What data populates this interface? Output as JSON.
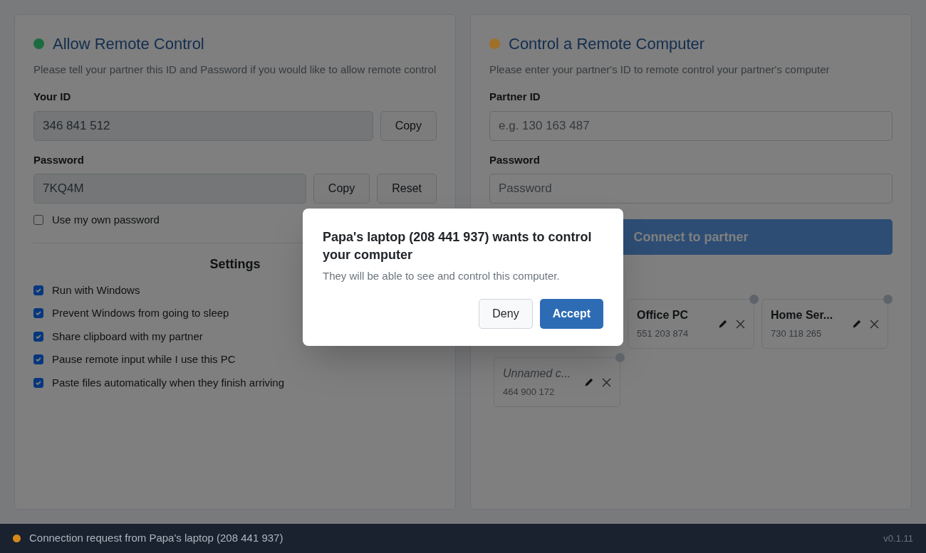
{
  "allow": {
    "title": "Allow Remote Control",
    "color": "#1d6b40",
    "description": "Please tell your partner this ID and Password if you would like to allow remote control",
    "id_label": "Your ID",
    "id_value": "346 841 512",
    "id_copy": "Copy",
    "password_label": "Password",
    "password_value": "7KQ4M",
    "password_copy": "Copy",
    "password_reset": "Reset",
    "own_password": {
      "label": "Use my own password",
      "checked": false
    },
    "settings_title": "Settings",
    "settings": [
      {
        "label": "Run with Windows",
        "checked": true
      },
      {
        "label": "Prevent Windows from going to sleep",
        "checked": true
      },
      {
        "label": "Share clipboard with my partner",
        "checked": true
      },
      {
        "label": "Pause remote input while I use this PC",
        "checked": true
      },
      {
        "label": "Paste files automatically when they finish arriving",
        "checked": true
      }
    ]
  },
  "control": {
    "title": "Control a Remote Computer",
    "color": "#a0702a",
    "description": "Please enter your partner's ID to remote control your partner's computer",
    "partner_id_label": "Partner ID",
    "partner_id_placeholder": "e.g. 130 163 487",
    "password_label": "Password",
    "password_placeholder": "Password",
    "connect": "Connect to partner",
    "partners": [
      {
        "kind": "hidden"
      },
      {
        "kind": "named",
        "name": "Office PC",
        "id": "551 203 874",
        "color": "#5f646b"
      },
      {
        "kind": "named",
        "name": "Home Ser...",
        "id": "730 118 265",
        "color": "#5f646b"
      },
      {
        "kind": "unnamed",
        "name": "Unnamed c...",
        "id": "464 900 172",
        "color": "#5f646b"
      }
    ]
  },
  "dialog": {
    "title": "Papa's laptop (208 441 937) wants to control your computer",
    "message": "They will be able to see and control this computer.",
    "deny": "Deny",
    "accept": "Accept"
  },
  "status_bar": {
    "message": "Connection request from Papa's laptop (208 441 937)",
    "color": "#d4891c",
    "version": "v0.1.11"
  }
}
